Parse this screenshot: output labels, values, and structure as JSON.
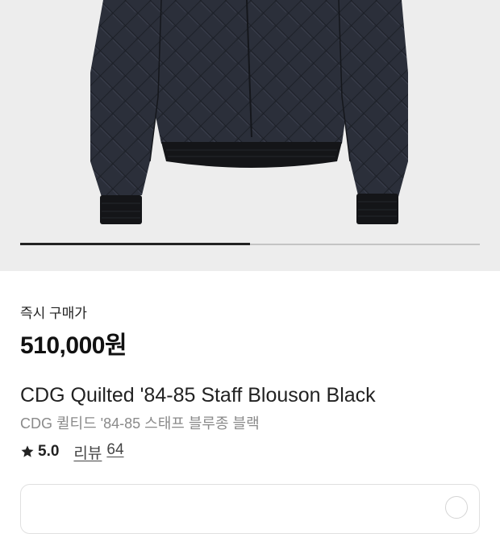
{
  "product_image": {
    "description_icon": "jacket-photo",
    "background": "#ededed",
    "carousel_progress": 0.5
  },
  "pricing": {
    "label": "즉시 구매가",
    "price": "510,000원"
  },
  "product": {
    "name_en": "CDG Quilted '84-85 Staff Blouson Black",
    "name_ko": "CDG 퀼티드 '84-85 스태프 블루종 블랙"
  },
  "rating": {
    "icon": "star-icon",
    "value": "5.0",
    "review_label": "리뷰",
    "review_count": "64"
  },
  "bottom_card": {
    "icon": "circle-icon"
  }
}
